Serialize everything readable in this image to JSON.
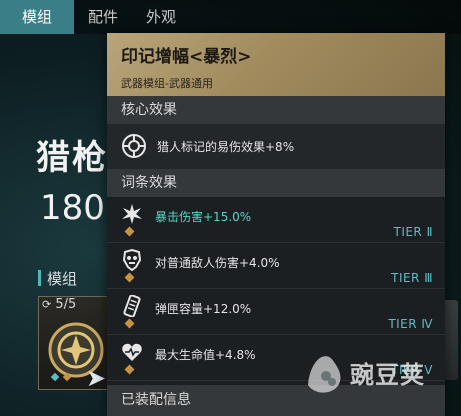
{
  "tabs": [
    {
      "label": "模组",
      "active": true
    },
    {
      "label": "配件",
      "active": false
    },
    {
      "label": "外观",
      "active": false
    }
  ],
  "background": {
    "weapon_name": "猎枪·",
    "weapon_value": "180",
    "section_label": "模组",
    "mod_count": "5/5"
  },
  "tooltip": {
    "title": "印记增幅<暴烈>",
    "subtitle": "武器模组-武器通用",
    "core_section": "核心效果",
    "core_effect": "猎人标记的易伤效果+8%",
    "perks_section": "词条效果",
    "perks": [
      {
        "label": "暴击伤害+15.0%",
        "tier": "TIER Ⅱ",
        "highlight": true,
        "icon": "explosion-icon"
      },
      {
        "label": "对普通敌人伤害+4.0%",
        "tier": "TIER Ⅲ",
        "highlight": false,
        "icon": "enemy-damage-icon"
      },
      {
        "label": "弹匣容量+12.0%",
        "tier": "TIER Ⅳ",
        "highlight": false,
        "icon": "magazine-icon"
      },
      {
        "label": "最大生命值+4.8%",
        "tier": "TIER Ⅴ",
        "highlight": false,
        "icon": "heart-icon"
      }
    ],
    "footer": "已装配信息"
  },
  "watermark": {
    "text": "豌豆荚"
  },
  "colors": {
    "tab_active": "#3a7e88",
    "header_gold": "#b9a57c",
    "tier": "#5fbcc4",
    "highlight": "#57d6c4",
    "perk_dot": "#c7933f"
  }
}
